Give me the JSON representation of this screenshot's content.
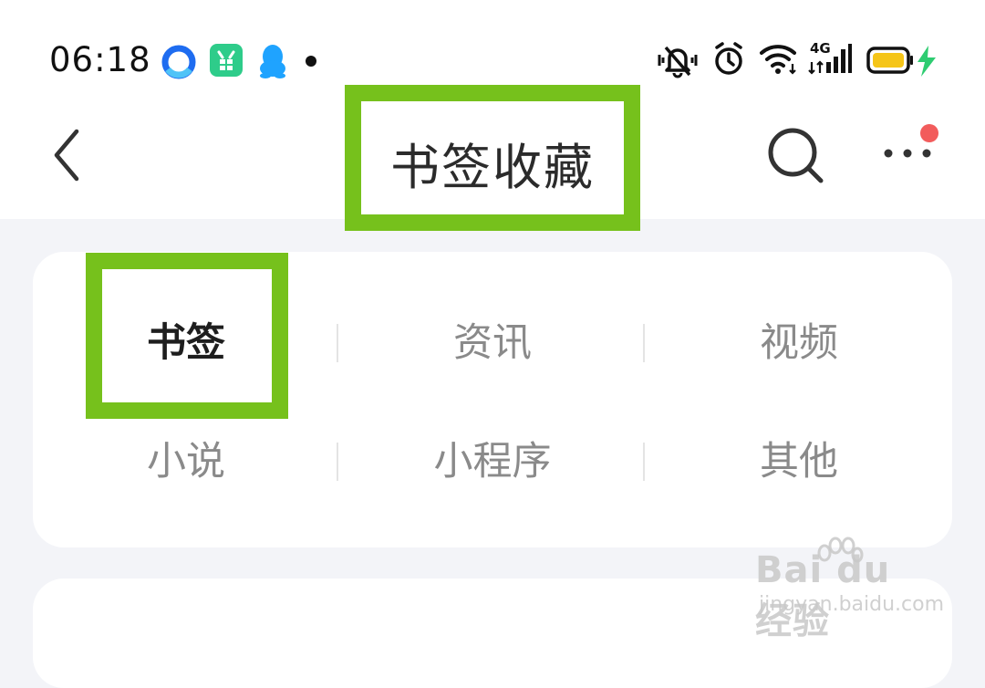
{
  "status_bar": {
    "time": "06:18",
    "apps": [
      "browser-icon",
      "tool-app-icon",
      "qq-icon"
    ],
    "network_label": "4G"
  },
  "nav": {
    "title": "书签收藏"
  },
  "tabs": [
    {
      "label": "书签",
      "active": true
    },
    {
      "label": "资讯",
      "active": false
    },
    {
      "label": "视频",
      "active": false
    },
    {
      "label": "小说",
      "active": false
    },
    {
      "label": "小程序",
      "active": false
    },
    {
      "label": "其他",
      "active": false
    }
  ],
  "watermark": {
    "brand": "Bai du 经验",
    "url": "jingyan.baidu.com"
  },
  "colors": {
    "highlight": "#76c11c",
    "notification_dot": "#f25c5c",
    "battery": "#f5c518",
    "charging": "#2ecc71"
  }
}
